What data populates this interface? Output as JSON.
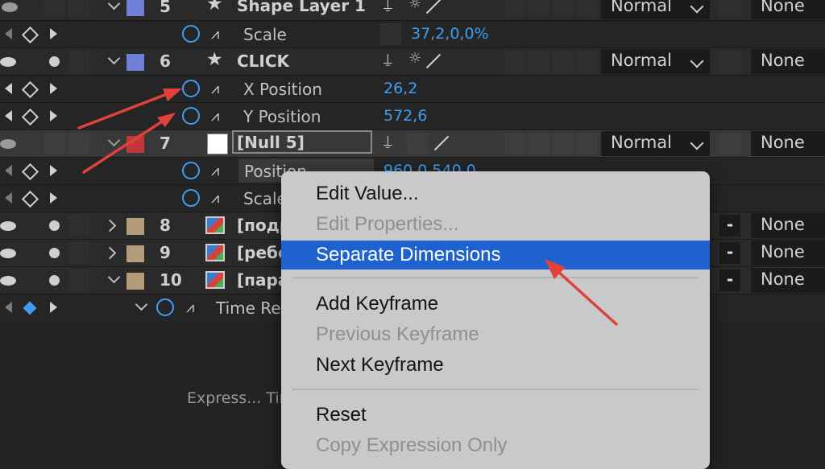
{
  "layers": [
    {
      "num": "5",
      "name": "Shape Layer 1",
      "mode": "Normal",
      "trkmat": "None"
    },
    {
      "num": "6",
      "name": "CLICK",
      "mode": "Normal",
      "trkmat": "None"
    },
    {
      "num": "7",
      "name": "[Null 5]",
      "mode": "Normal",
      "trkmat": "None"
    },
    {
      "num": "8",
      "name": "[подр",
      "trkmat": "None"
    },
    {
      "num": "9",
      "name": "[ребе",
      "trkmat": "None"
    },
    {
      "num": "10",
      "name": "[пара",
      "trkmat": "None"
    }
  ],
  "props": {
    "scale_5": {
      "name": "Scale",
      "value": "37,2,0,0%"
    },
    "xpos_6": {
      "name": "X Position",
      "value": "26,2"
    },
    "ypos_6": {
      "name": "Y Position",
      "value": "572,6"
    },
    "pos_7": {
      "name": "Position",
      "value": "960,0,540,0"
    },
    "scale_7": {
      "name": "Scale"
    },
    "time_remap_10": {
      "name": "Time Re"
    }
  },
  "footer": {
    "expression": "Express... Tim"
  },
  "menu": {
    "edit_value": "Edit Value...",
    "edit_properties": "Edit Properties...",
    "separate_dimensions": "Separate Dimensions",
    "add_keyframe": "Add Keyframe",
    "previous_keyframe": "Previous Keyframe",
    "next_keyframe": "Next Keyframe",
    "reset": "Reset",
    "copy_expression_only": "Copy Expression Only"
  },
  "colors": {
    "accent_blue": "#3e9df2",
    "label_violet": "#6f7fd6",
    "label_red": "#c0363a",
    "label_tan": "#b39b79",
    "menu_highlight": "#1e62cf",
    "annotation_arrow": "#e0413b"
  }
}
